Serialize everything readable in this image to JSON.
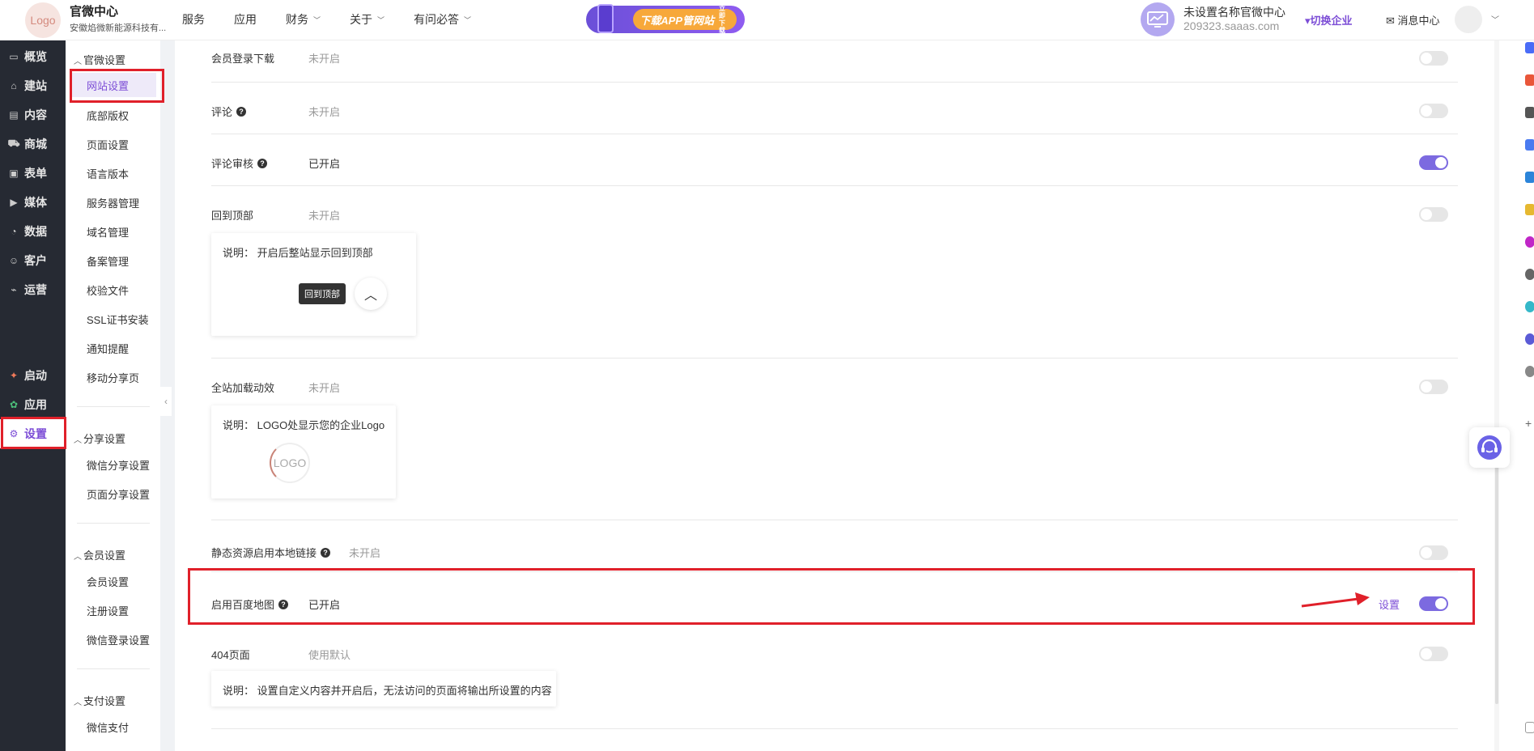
{
  "header": {
    "logo_text": "Logo",
    "brand_name": "官微中心",
    "brand_sub": "安徽焰微新能源科技有...",
    "nav": [
      {
        "label": "服务",
        "has_menu": false
      },
      {
        "label": "应用",
        "has_menu": false
      },
      {
        "label": "财务",
        "has_menu": true
      },
      {
        "label": "关于",
        "has_menu": true
      },
      {
        "label": "有问必答",
        "has_menu": true
      }
    ],
    "banner_label": "下载APP管网站",
    "banner_small": "立即下载",
    "company_name": "未设置名称官微中心",
    "company_domain": "209323.saaas.com",
    "switch_company": "▾切换企业",
    "message_center": "✉ 消息中心"
  },
  "sidebar": {
    "items": [
      {
        "label": "概览",
        "icon": "dashboard-icon",
        "glyph": "▭"
      },
      {
        "label": "建站",
        "icon": "home-icon",
        "glyph": "⌂"
      },
      {
        "label": "内容",
        "icon": "document-icon",
        "glyph": "▤"
      },
      {
        "label": "商城",
        "icon": "cart-icon",
        "glyph": "⛟"
      },
      {
        "label": "表单",
        "icon": "form-icon",
        "glyph": "▣"
      },
      {
        "label": "媒体",
        "icon": "video-icon",
        "glyph": "▶"
      },
      {
        "label": "数据",
        "icon": "chart-icon",
        "glyph": "◔"
      },
      {
        "label": "客户",
        "icon": "user-icon",
        "glyph": "☺"
      },
      {
        "label": "运营",
        "icon": "paperclip-icon",
        "glyph": "⌁"
      }
    ],
    "bottom_items": [
      {
        "label": "启动",
        "icon": "launch-icon",
        "glyph": "✦"
      },
      {
        "label": "应用",
        "icon": "apps-icon",
        "glyph": "✿"
      },
      {
        "label": "设置",
        "icon": "gear-icon",
        "glyph": "⚙"
      }
    ]
  },
  "submenu": {
    "group1": "官微设置",
    "group1_items": [
      "网站设置",
      "底部版权",
      "页面设置",
      "语言版本",
      "服务器管理",
      "域名管理",
      "备案管理",
      "校验文件",
      "SSL证书安装",
      "通知提醒",
      "移动分享页"
    ],
    "group2": "分享设置",
    "group2_items": [
      "微信分享设置",
      "页面分享设置"
    ],
    "group3": "会员设置",
    "group3_items": [
      "会员设置",
      "注册设置",
      "微信登录设置"
    ],
    "group4": "支付设置",
    "group4_items": [
      "微信支付"
    ]
  },
  "settings": {
    "member_download": {
      "label": "会员登录下载",
      "status": "未开启",
      "enabled": false
    },
    "comment": {
      "label": "评论",
      "status": "未开启",
      "enabled": false
    },
    "comment_review": {
      "label": "评论审核",
      "status": "已开启",
      "enabled": true
    },
    "back_to_top": {
      "label": "回到顶部",
      "status": "未开启",
      "enabled": false,
      "note": "说明：  开启后整站显示回到顶部",
      "tip": "回到顶部"
    },
    "loading_effect": {
      "label": "全站加载动效",
      "status": "未开启",
      "enabled": false,
      "note": "说明：  LOGO处显示您的企业Logo",
      "logo_text": "LOGO"
    },
    "static_local": {
      "label": "静态资源启用本地链接",
      "status": "未开启",
      "enabled": false
    },
    "baidu_map": {
      "label": "启用百度地图",
      "status": "已开启",
      "enabled": true,
      "set_label": "设置"
    },
    "page_404": {
      "label": "404页面",
      "status": "使用默认",
      "enabled": false,
      "note": "说明：  设置自定义内容并开启后，无法访问的页面将输出所设置的内容"
    }
  },
  "colors": {
    "accent": "#7c4dd6",
    "toggle_on": "#7c6ae0",
    "annotation_red": "#e0202a",
    "sidebar_bg": "#262a33"
  }
}
